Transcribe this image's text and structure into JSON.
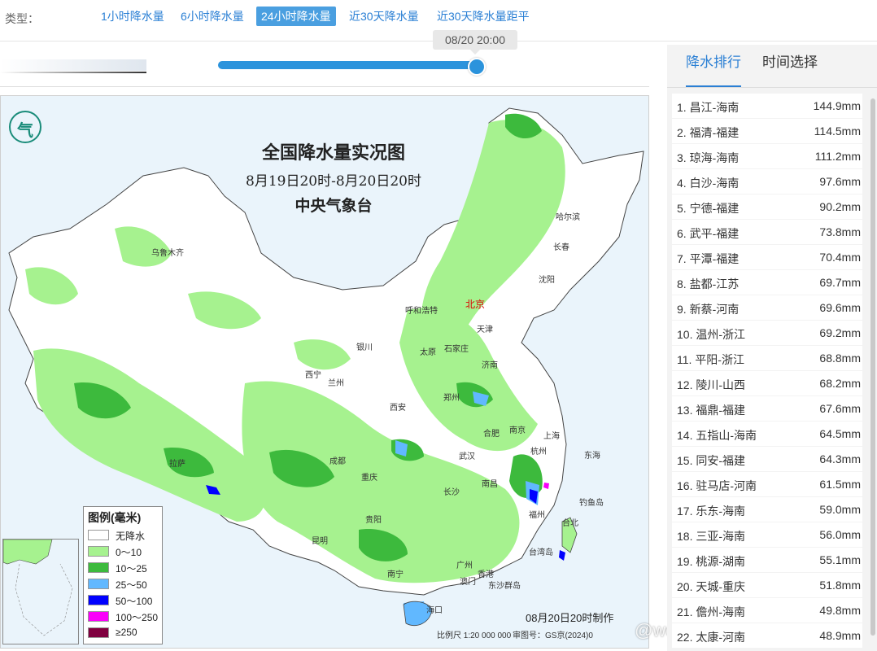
{
  "type_bar": {
    "label": "类型：",
    "tabs": [
      "1小时降水量",
      "6小时降水量",
      "24小时降水量",
      "近30天降水量",
      "近30天降水量距平"
    ],
    "active_index": 2
  },
  "time_slider": {
    "current_time": "08/20 20:00",
    "progress": 1.0
  },
  "map": {
    "title": "全国降水量实况图",
    "period": "8月19日20时-8月20日20时",
    "issuer": "中央气象台",
    "made_time": "08月20日20时制作",
    "scale": "比例尺 1:20 000 000",
    "review_no": "审图号：GS京(2024)0",
    "cities": [
      "乌鲁木齐",
      "哈尔滨",
      "长春",
      "沈阳",
      "呼和浩特",
      "北京",
      "天津",
      "银川",
      "太原",
      "石家庄",
      "济南",
      "西宁",
      "兰州",
      "郑州",
      "西安",
      "合肥",
      "南京",
      "上海",
      "拉萨",
      "成都",
      "武汉",
      "杭州",
      "重庆",
      "长沙",
      "南昌",
      "福州",
      "台北",
      "贵阳",
      "昆明",
      "广州",
      "香港",
      "澳门",
      "南宁",
      "海口",
      "东海",
      "台湾岛",
      "钓鱼岛",
      "东沙群岛"
    ],
    "legend": {
      "title": "图例(毫米)",
      "items": [
        {
          "label": "无降水",
          "color": "#ffffff"
        },
        {
          "label": "0～10",
          "color": "#a6f28f"
        },
        {
          "label": "10～25",
          "color": "#3dba3d"
        },
        {
          "label": "25～50",
          "color": "#61b8ff"
        },
        {
          "label": "50～100",
          "color": "#0000ff"
        },
        {
          "label": "100～250",
          "color": "#fa00fa"
        },
        {
          "label": "≥250",
          "color": "#800040"
        }
      ]
    }
  },
  "watermark": "@weatherman_信欣",
  "panel": {
    "tabs": [
      "降水排行",
      "时间选择"
    ],
    "active_index": 0,
    "ranking": [
      {
        "name": "1. 昌江-海南",
        "value": "144.9mm"
      },
      {
        "name": "2. 福清-福建",
        "value": "114.5mm"
      },
      {
        "name": "3. 琼海-海南",
        "value": "111.2mm"
      },
      {
        "name": "4. 白沙-海南",
        "value": "97.6mm"
      },
      {
        "name": "5. 宁德-福建",
        "value": "90.2mm"
      },
      {
        "name": "6. 武平-福建",
        "value": "73.8mm"
      },
      {
        "name": "7. 平潭-福建",
        "value": "70.4mm"
      },
      {
        "name": "8. 盐都-江苏",
        "value": "69.7mm"
      },
      {
        "name": "9. 新蔡-河南",
        "value": "69.6mm"
      },
      {
        "name": "10. 温州-浙江",
        "value": "69.2mm"
      },
      {
        "name": "11. 平阳-浙江",
        "value": "68.8mm"
      },
      {
        "name": "12. 陵川-山西",
        "value": "68.2mm"
      },
      {
        "name": "13. 福鼎-福建",
        "value": "67.6mm"
      },
      {
        "name": "14. 五指山-海南",
        "value": "64.5mm"
      },
      {
        "name": "15. 同安-福建",
        "value": "64.3mm"
      },
      {
        "name": "16. 驻马店-河南",
        "value": "61.5mm"
      },
      {
        "name": "17. 乐东-海南",
        "value": "59.0mm"
      },
      {
        "name": "18. 三亚-海南",
        "value": "56.0mm"
      },
      {
        "name": "19. 桃源-湖南",
        "value": "55.1mm"
      },
      {
        "name": "20. 天城-重庆",
        "value": "51.8mm"
      },
      {
        "name": "21. 儋州-海南",
        "value": "49.8mm"
      },
      {
        "name": "22. 太康-河南",
        "value": "48.9mm"
      }
    ]
  }
}
